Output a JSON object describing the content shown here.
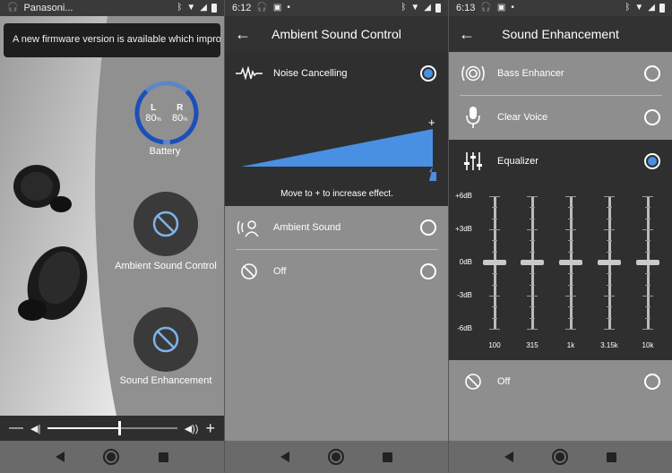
{
  "panel1": {
    "status": {
      "app": "Panasoni..."
    },
    "toast": "A new firmware version is available which improve..",
    "battery": {
      "left_label": "L",
      "right_label": "R",
      "left_pct": "80",
      "right_pct": "80",
      "unit": "%",
      "label": "Battery",
      "level": 0.8
    },
    "ambient_label": "Ambient Sound Control",
    "enhancement_label": "Sound Enhancement",
    "volume": {
      "minus": "—",
      "plus": "+",
      "level": 0.55
    }
  },
  "panel2": {
    "status": {
      "time": "6:12"
    },
    "title": "Ambient Sound Control",
    "items": [
      {
        "label": "Noise Cancelling",
        "selected": true,
        "icon": "noise-cancelling-icon"
      },
      {
        "label": "Ambient Sound",
        "selected": false,
        "icon": "ambient-sound-icon"
      },
      {
        "label": "Off",
        "selected": false,
        "icon": "off-icon"
      }
    ],
    "slider_plus": "+",
    "hint": "Move to + to increase effect.",
    "accent": "#4a90e2"
  },
  "panel3": {
    "status": {
      "time": "6:13"
    },
    "title": "Sound Enhancement",
    "items": [
      {
        "label": "Bass Enhancer",
        "selected": false,
        "icon": "bass-icon"
      },
      {
        "label": "Clear Voice",
        "selected": false,
        "icon": "microphone-icon"
      },
      {
        "label": "Equalizer",
        "selected": true,
        "icon": "equalizer-icon"
      },
      {
        "label": "Off",
        "selected": false,
        "icon": "off-icon"
      }
    ],
    "eq": {
      "db_labels": [
        "+6dB",
        "+3dB",
        "0dB",
        "-3dB",
        "-6dB"
      ],
      "bands": [
        "100",
        "315",
        "1k",
        "3.15k",
        "10k"
      ],
      "values_db": [
        0,
        0,
        0,
        0,
        0
      ]
    }
  }
}
